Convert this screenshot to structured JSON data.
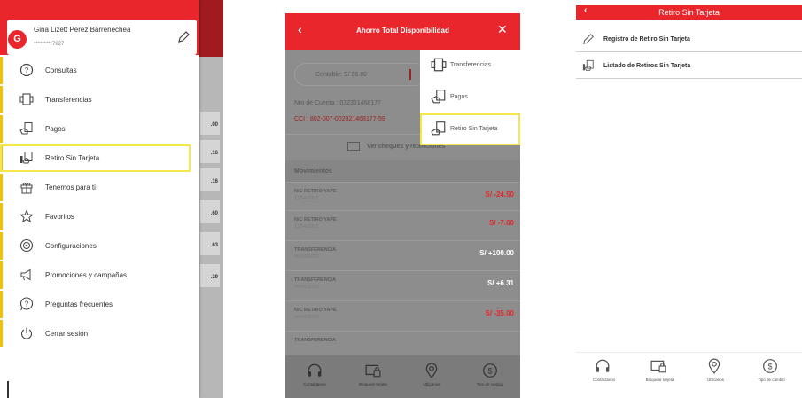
{
  "drawer": {
    "user_name": "Gina Lizett Perez Barrenechea",
    "user_number": "*********7827",
    "avatar_letter": "G",
    "items": [
      {
        "label": "Consultas",
        "icon": "question-circle-icon"
      },
      {
        "label": "Transferencias",
        "icon": "transfer-icon"
      },
      {
        "label": "Pagos",
        "icon": "payment-icon"
      },
      {
        "label": "Retiro Sin Tarjeta",
        "icon": "cardless-withdrawal-icon",
        "selected": true
      },
      {
        "label": "Tenemos para ti",
        "icon": "gift-icon"
      },
      {
        "label": "Favoritos",
        "icon": "star-icon"
      },
      {
        "label": "Configuraciones",
        "icon": "gear-icon"
      },
      {
        "label": "Promociones y campañas",
        "icon": "megaphone-icon"
      },
      {
        "label": "Preguntas frecuentes",
        "icon": "faq-icon"
      },
      {
        "label": "Cerrar sesión",
        "icon": "power-icon"
      }
    ],
    "background_values": [
      ".00",
      ".16",
      ".16",
      ".60",
      ".63",
      ".39"
    ]
  },
  "account": {
    "title": "Ahorro Total Disponibilidad",
    "contable": "Contable: S/ 96.60",
    "account_number": "Nro de Cuenta : 072321468177",
    "cci": "CCI : 802-007-002321468177-59",
    "cheques_link": "Ver cheques y retenciones",
    "movements_header": "Movimientos",
    "movements": [
      {
        "name": "N/C RETIRO YAPE",
        "date": "11/04/2022",
        "amount": "S/ -24.50",
        "type": "neg"
      },
      {
        "name": "N/C RETIRO YAPE",
        "date": "11/04/2022",
        "amount": "S/ -7.00",
        "type": "neg"
      },
      {
        "name": "TRANSFERENCIA",
        "date": "08/04/2022",
        "amount": "S/ +100.00",
        "type": "pos"
      },
      {
        "name": "TRANSFERENCIA",
        "date": "08/04/2022",
        "amount": "S/ +6.31",
        "type": "pos"
      },
      {
        "name": "N/C RETIRO YAPE",
        "date": "08/04/2022",
        "amount": "S/ -35.00",
        "type": "neg"
      },
      {
        "name": "TRANSFERENCIA",
        "date": "",
        "amount": "",
        "type": "neg"
      }
    ],
    "popup": [
      {
        "label": "Transferencias",
        "icon": "transfer-icon"
      },
      {
        "label": "Pagos",
        "icon": "payment-icon"
      },
      {
        "label": "Retiro Sin Tarjeta",
        "icon": "cardless-withdrawal-icon",
        "selected": true
      }
    ]
  },
  "retiro": {
    "title": "Retiro Sin Tarjeta",
    "items": [
      {
        "label": "Registro de Retiro Sin Tarjeta",
        "icon": "pencil-icon"
      },
      {
        "label": "Listado de Retiros Sin Tarjeta",
        "icon": "cardless-withdrawal-icon"
      }
    ]
  },
  "tabbar": [
    {
      "label": "Contáctanos",
      "icon": "headset-icon"
    },
    {
      "label": "Bloquear tarjeta",
      "icon": "card-lock-icon"
    },
    {
      "label": "Ubícanos",
      "icon": "location-pin-icon"
    },
    {
      "label": "Tipo de cambio",
      "icon": "currency-exchange-icon"
    }
  ],
  "colors": {
    "brand_red": "#e8262b",
    "highlight_yellow": "#f5e64a",
    "accent_bar": "#f2c200",
    "negative": "#e8262b",
    "positive": "#ffffff"
  }
}
